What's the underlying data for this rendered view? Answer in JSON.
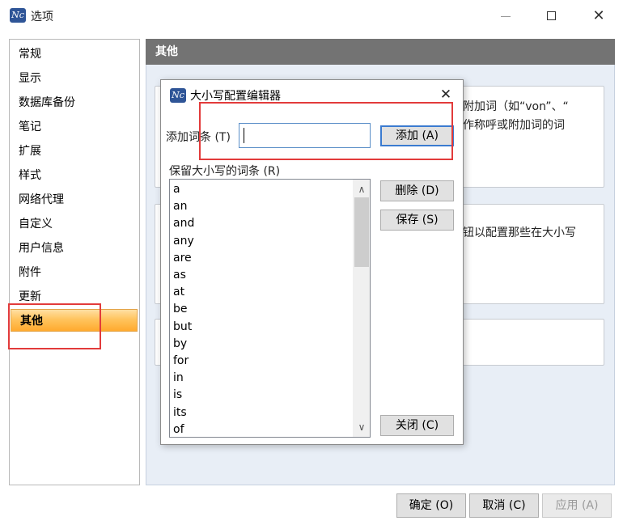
{
  "window": {
    "title": "选项",
    "icon_text": "Nc",
    "minimize_glyph": "—",
    "close_glyph": "✕"
  },
  "sidebar": {
    "items": [
      {
        "label": "常规"
      },
      {
        "label": "显示"
      },
      {
        "label": "数据库备份"
      },
      {
        "label": "笔记"
      },
      {
        "label": "扩展"
      },
      {
        "label": "样式"
      },
      {
        "label": "网络代理"
      },
      {
        "label": "自定义"
      },
      {
        "label": "用户信息"
      },
      {
        "label": "附件"
      },
      {
        "label": "更新"
      },
      {
        "label": "其他",
        "selected": true
      }
    ]
  },
  "content": {
    "header": "其他",
    "group1_line1": "附加词（如“von”、“",
    "group1_line2": "作称呼或附加词的词",
    "group2_line1": "钮以配置那些在大小写"
  },
  "footer": {
    "ok_label": "确定 (O)",
    "cancel_label": "取消 (C)",
    "apply_label": "应用 (A)"
  },
  "dialog": {
    "title": "大小写配置编辑器",
    "close_glyph": "✕",
    "add_term_label": "添加词条 (T)",
    "add_term_value": "",
    "add_button": "添加 (A)",
    "list_label": "保留大小写的词条 (R)",
    "delete_button": "删除 (D)",
    "save_button": "保存 (S)",
    "close_button": "关闭 (C)",
    "terms": [
      "a",
      "an",
      "and",
      "any",
      "are",
      "as",
      "at",
      "be",
      "but",
      "by",
      "for",
      "in",
      "is",
      "its",
      "of"
    ],
    "scroll_up_glyph": "∧",
    "scroll_down_glyph": "∨"
  },
  "colors": {
    "highlight_box": "#e23b3b",
    "header_bg": "#737373",
    "selected_nav": "#ffc45e",
    "panel_bg": "#e8eef6"
  }
}
